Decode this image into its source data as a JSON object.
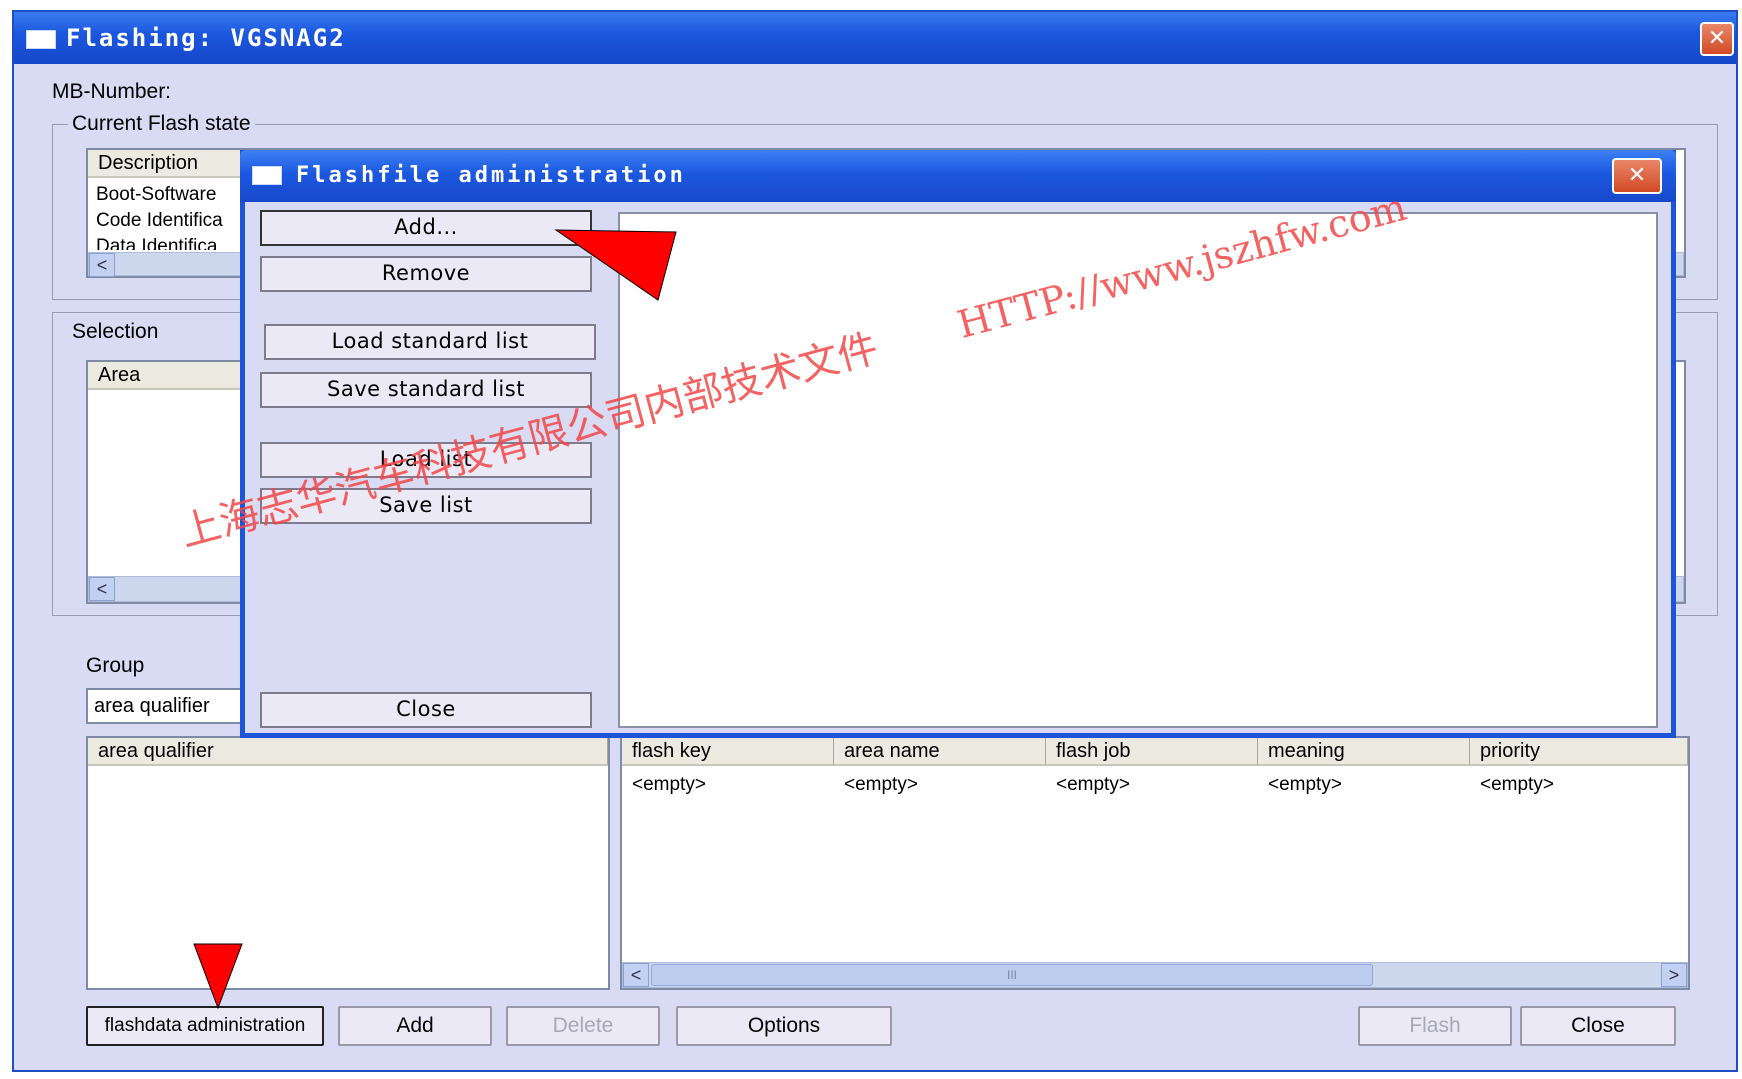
{
  "main_window": {
    "title": "Flashing: VGSNAG2",
    "close_glyph": "✕",
    "mb_number_label": "MB-Number:",
    "current_flash_state": {
      "title": "Current Flash state",
      "column_header": "Description",
      "rows": [
        "Boot-Software",
        "Code Identifica",
        "Data Identifica"
      ]
    },
    "selection": {
      "title": "Selection",
      "column_header": "Area"
    },
    "group": {
      "label": "Group",
      "value": "area qualifier"
    },
    "area_qualifier_header": "area qualifier",
    "flash_table": {
      "columns": [
        "flash key",
        "area name",
        "flash job",
        "meaning",
        "priority"
      ],
      "row": [
        "<empty>",
        "<empty>",
        "<empty>",
        "<empty>",
        "<empty>"
      ]
    },
    "scroll_thumb": "III",
    "buttons": {
      "flashdata_admin": "flashdata administration",
      "add": "Add",
      "delete": "Delete",
      "options": "Options",
      "flash": "Flash",
      "close": "Close"
    }
  },
  "dialog": {
    "title": "Flashfile administration",
    "close_glyph": "✕",
    "buttons": {
      "add": "Add...",
      "remove": "Remove",
      "load_standard_list": "Load standard list",
      "save_standard_list": "Save standard list",
      "load_list": "Load list",
      "save_list": "Save list",
      "close": "Close"
    }
  },
  "watermark": {
    "chinese": "上海志华汽车科技有限公司内部技术文件",
    "url": "HTTP://www.jszhfw.com"
  },
  "colors": {
    "titlebar": "#1b58df",
    "window_bg": "#d8dbf3",
    "annotation_arrow": "#ff0000",
    "watermark": "#f34747"
  }
}
